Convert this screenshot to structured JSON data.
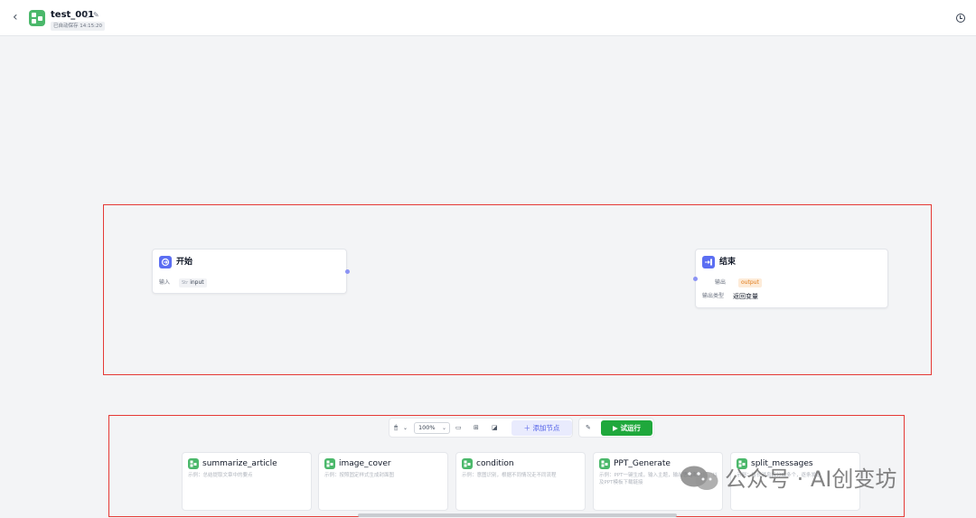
{
  "header": {
    "title": "test_001",
    "autosave": "已自动保存 14:15:20"
  },
  "nodes": {
    "start": {
      "title": "开始",
      "input_label": "输入",
      "input_type": "Str",
      "input_name": "input"
    },
    "end": {
      "title": "结束",
      "output_label": "输出",
      "output_name": "output",
      "output_type_label": "输出类型",
      "output_type_value": "返回变量"
    }
  },
  "toolbar": {
    "zoom": "100%",
    "add_node": "添加节点",
    "run": "试运行"
  },
  "templates": [
    {
      "title": "summarize_article",
      "desc": "示例：总结提取文章中的要点"
    },
    {
      "title": "image_cover",
      "desc": "示例：按照固定样式生成封面图"
    },
    {
      "title": "condition",
      "desc": "示例：意图识别，根据不同情况走不同流程"
    },
    {
      "title": "PPT_Generate",
      "desc": "示例：PPT一键生成，输入主题，输出思路和大纲，以及PPT模板下载链接"
    },
    {
      "title": "split_messages",
      "desc": "示例：将长消息拆分成多个，逐条发送"
    }
  ],
  "watermark": "公众号 · AI创变坊",
  "colors": {
    "accent": "#5b6ef2",
    "run_green": "#1fa83c",
    "template_green": "#4bb86b",
    "highlight_red": "#e53935"
  },
  "icons": {
    "back": "chevron-left-icon",
    "info": "info-icon",
    "edit": "edit-icon",
    "history": "history-icon"
  }
}
